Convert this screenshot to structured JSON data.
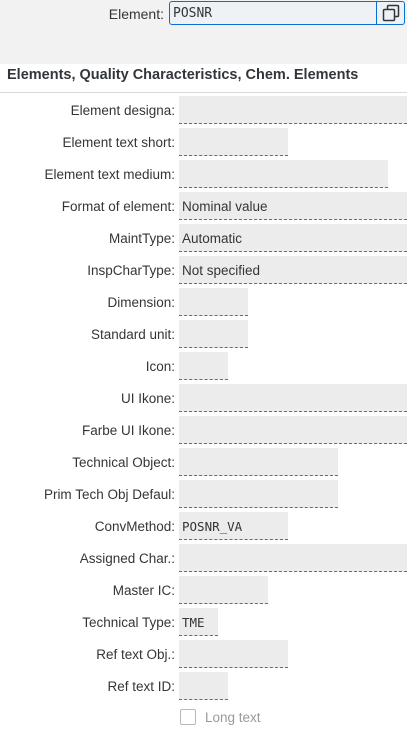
{
  "header": {
    "element_label": "Element:",
    "element_value": "POSNR"
  },
  "section": {
    "title": "Elements, Quality Characteristics, Chem. Elements"
  },
  "fields": [
    {
      "label": "Element designa:",
      "value": ""
    },
    {
      "label": "Element text short:",
      "value": ""
    },
    {
      "label": "Element text medium:",
      "value": ""
    },
    {
      "label": "Format of element:",
      "value": "Nominal value"
    },
    {
      "label": "MaintType:",
      "value": "Automatic"
    },
    {
      "label": "InspCharType:",
      "value": "Not specified"
    },
    {
      "label": "Dimension:",
      "value": ""
    },
    {
      "label": "Standard unit:",
      "value": ""
    },
    {
      "label": "Icon:",
      "value": ""
    },
    {
      "label": "UI Ikone:",
      "value": ""
    },
    {
      "label": "Farbe UI Ikone:",
      "value": ""
    },
    {
      "label": "Technical Object:",
      "value": ""
    },
    {
      "label": "Prim Tech Obj Defaul:",
      "value": ""
    },
    {
      "label": "ConvMethod:",
      "value": "POSNR_VA"
    },
    {
      "label": "Assigned Char.:",
      "value": ""
    },
    {
      "label": "Master IC:",
      "value": ""
    },
    {
      "label": "Technical Type:",
      "value": "TME"
    },
    {
      "label": "Ref text Obj.:",
      "value": ""
    },
    {
      "label": "Ref text ID:",
      "value": ""
    }
  ],
  "long_text": {
    "label": "Long text",
    "checked": false
  },
  "colors": {
    "accent": "#0a6ed1",
    "field_bg": "#ececec",
    "header_bg": "#f2f2f2"
  }
}
